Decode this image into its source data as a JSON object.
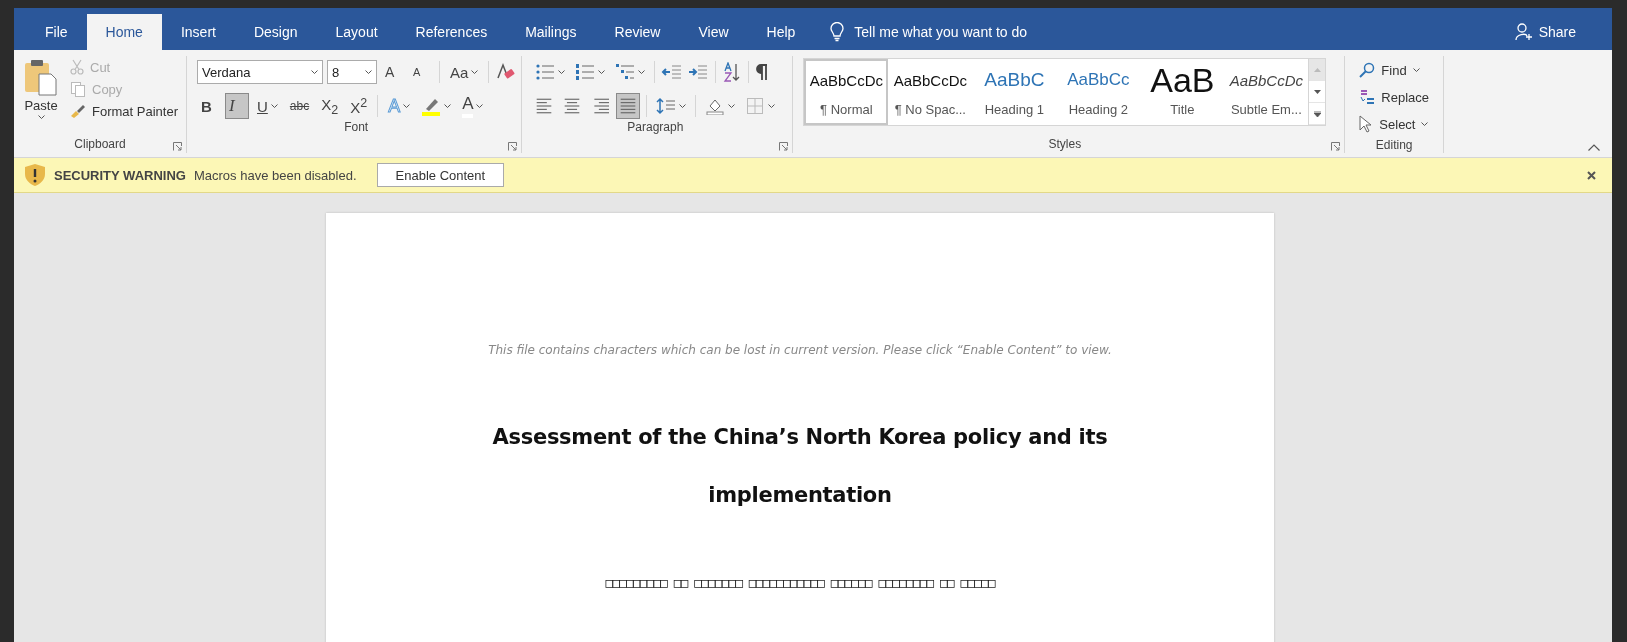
{
  "tabs": [
    {
      "label": "File",
      "selected": false
    },
    {
      "label": "Home",
      "selected": true
    },
    {
      "label": "Insert",
      "selected": false
    },
    {
      "label": "Design",
      "selected": false
    },
    {
      "label": "Layout",
      "selected": false
    },
    {
      "label": "References",
      "selected": false
    },
    {
      "label": "Mailings",
      "selected": false
    },
    {
      "label": "Review",
      "selected": false
    },
    {
      "label": "View",
      "selected": false
    },
    {
      "label": "Help",
      "selected": false
    }
  ],
  "tell_me": "Tell me what you want to do",
  "share": "Share",
  "clipboard": {
    "label": "Clipboard",
    "paste": "Paste",
    "items": [
      {
        "kind": "cut",
        "label": "Cut",
        "disabled": true
      },
      {
        "kind": "copy",
        "label": "Copy",
        "disabled": true
      },
      {
        "kind": "painter",
        "label": "Format Painter",
        "disabled": false
      }
    ]
  },
  "font": {
    "label": "Font",
    "name": "Verdana",
    "size": "8",
    "size_buttons": [
      {
        "kind": "grow",
        "label": "A"
      },
      {
        "kind": "shrink",
        "label": "A"
      },
      {
        "kind": "case",
        "label": "Aa"
      }
    ],
    "format_buttons": [
      {
        "kind": "bold",
        "label": "B",
        "selected": false
      },
      {
        "kind": "italic",
        "label": "I",
        "selected": true
      },
      {
        "kind": "underline",
        "label": "U",
        "selected": false
      },
      {
        "kind": "strike",
        "label": "abc",
        "selected": false
      },
      {
        "kind": "sub",
        "label": "X$_{2}$",
        "selected": false
      },
      {
        "kind": "sup",
        "label": "X$^{2}$",
        "selected": false
      }
    ],
    "effect_buttons": [
      {
        "kind": "effects",
        "label": "A"
      },
      {
        "kind": "highlight"
      },
      {
        "kind": "color",
        "label": "A"
      }
    ]
  },
  "paragraph": {
    "label": "Paragraph",
    "alignments": [
      {
        "kind": "left",
        "selected": false
      },
      {
        "kind": "center",
        "selected": false
      },
      {
        "kind": "right",
        "selected": false
      },
      {
        "kind": "justify",
        "selected": true
      }
    ]
  },
  "styles": {
    "label": "Styles",
    "items": [
      {
        "kind": "normal",
        "preview": "AaBbCcDc",
        "name": "¶ Normal",
        "selected": true
      },
      {
        "kind": "plain",
        "preview": "AaBbCcDc",
        "name": "¶ No Spac...",
        "selected": false
      },
      {
        "kind": "heading1",
        "preview": "AaBbC",
        "name": "Heading 1",
        "selected": false
      },
      {
        "kind": "heading2",
        "preview": "AaBbCc",
        "name": "Heading 2",
        "selected": false
      },
      {
        "kind": "title",
        "preview": "AaB",
        "name": "Title",
        "selected": false
      },
      {
        "kind": "subtle",
        "preview": "AaBbCcDc",
        "name": "Subtle Em...",
        "selected": false
      }
    ]
  },
  "editing": {
    "label": "Editing",
    "items": [
      {
        "kind": "find",
        "label": "Find"
      },
      {
        "kind": "replace",
        "label": "Replace"
      },
      {
        "kind": "select",
        "label": "Select"
      }
    ]
  },
  "security": {
    "title": "SECURITY WARNING",
    "message": "Macros have been disabled.",
    "button": "Enable Content"
  },
  "document": {
    "notice": "This file contains characters which can be lost in current version. Please click  “Enable Content” to view.",
    "title_lines": [
      "Assessment of the China’s North Korea policy and its",
      "implementation"
    ],
    "garbled": "□□□□□□□□□ □□ □□□□□□□ □□□□□□□□□□□ □□□□□□ □□□□□□□□ □□ □□□□□"
  }
}
